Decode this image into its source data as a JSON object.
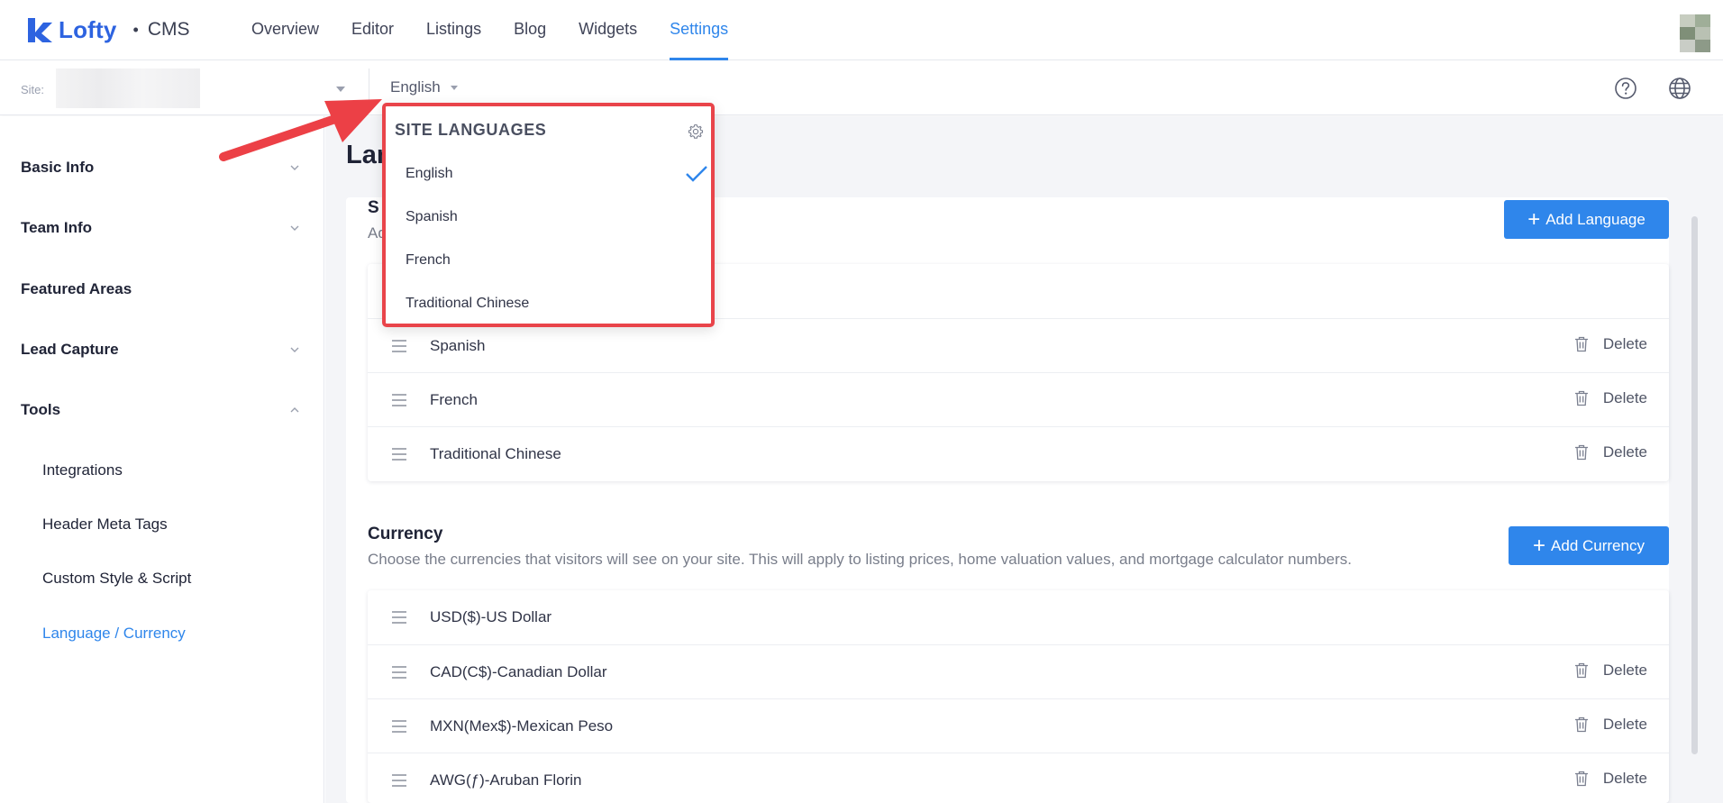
{
  "app": {
    "brand": "Lofty",
    "separator": "•",
    "product": "CMS"
  },
  "nav": {
    "tabs": [
      {
        "label": "Overview"
      },
      {
        "label": "Editor"
      },
      {
        "label": "Listings"
      },
      {
        "label": "Blog"
      },
      {
        "label": "Widgets"
      },
      {
        "label": "Settings",
        "active": true
      }
    ]
  },
  "subbar": {
    "site_label": "Site:",
    "language": "English"
  },
  "sidebar": {
    "items": [
      {
        "label": "Basic Info",
        "expanded": false
      },
      {
        "label": "Team Info",
        "expanded": false
      },
      {
        "label": "Featured Areas"
      },
      {
        "label": "Lead Capture",
        "expanded": false
      },
      {
        "label": "Tools",
        "expanded": true
      }
    ],
    "tools_children": [
      {
        "label": "Integrations"
      },
      {
        "label": "Header Meta Tags"
      },
      {
        "label": "Custom Style & Script"
      },
      {
        "label": "Language / Currency",
        "active": true
      }
    ]
  },
  "main": {
    "title": "Lan",
    "languages": {
      "title": "S",
      "desc": "Ad",
      "add_label": "Add Language",
      "rows": [
        {
          "label": "Spanish",
          "delete": "Delete"
        },
        {
          "label": "French",
          "delete": "Delete"
        },
        {
          "label": "Traditional Chinese",
          "delete": "Delete"
        }
      ]
    },
    "currency": {
      "title": "Currency",
      "desc": "Choose the currencies that visitors will see on your site. This will apply to listing prices, home valuation values, and mortgage calculator numbers.",
      "add_label": "Add Currency",
      "rows": [
        {
          "label": "USD($)-US Dollar"
        },
        {
          "label": "CAD(C$)-Canadian Dollar",
          "delete": "Delete"
        },
        {
          "label": "MXN(Mex$)-Mexican Peso",
          "delete": "Delete"
        },
        {
          "label": "AWG(ƒ)-Aruban Florin",
          "delete": "Delete"
        }
      ]
    }
  },
  "dropdown": {
    "title": "SITE LANGUAGES",
    "items": [
      {
        "label": "English",
        "selected": true
      },
      {
        "label": "Spanish"
      },
      {
        "label": "French"
      },
      {
        "label": "Traditional Chinese"
      }
    ]
  },
  "colors": {
    "accent": "#2f86eb",
    "brand": "#2d63e0",
    "highlight": "#e9444a"
  },
  "icons": [
    "lofty-logo-icon",
    "chevron-down-icon",
    "chevron-up-icon",
    "help-icon",
    "globe-icon",
    "drag-handle-icon",
    "trash-icon",
    "gear-icon",
    "check-icon",
    "plus-icon"
  ]
}
